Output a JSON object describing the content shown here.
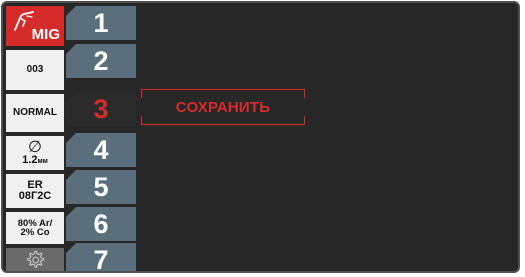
{
  "status_panel": {
    "process": {
      "label": "MIG",
      "icon": "welding-torch-icon"
    },
    "program": "003",
    "mode": "NORMAL",
    "wire_diameter": {
      "symbol": "∅",
      "value": "1.2",
      "unit": "мм"
    },
    "wire_type": {
      "line1": "ER",
      "line2": "08Г2С"
    },
    "gas": {
      "line1": "80% Ar/",
      "line2": "2% Co"
    },
    "settings": {
      "icon": "gear-icon"
    }
  },
  "memory_slots": [
    {
      "label": "1",
      "active": false
    },
    {
      "label": "2",
      "active": false
    },
    {
      "label": "3",
      "active": true
    },
    {
      "label": "4",
      "active": false
    },
    {
      "label": "5",
      "active": false
    },
    {
      "label": "6",
      "active": false
    },
    {
      "label": "7",
      "active": false
    }
  ],
  "dialog": {
    "save_label": "СОХРАНИТЬ"
  },
  "colors": {
    "background": "#272727",
    "accent": "#d52b2b",
    "slot": "#5a6e7b",
    "info_tile": "#f0f0f0"
  }
}
